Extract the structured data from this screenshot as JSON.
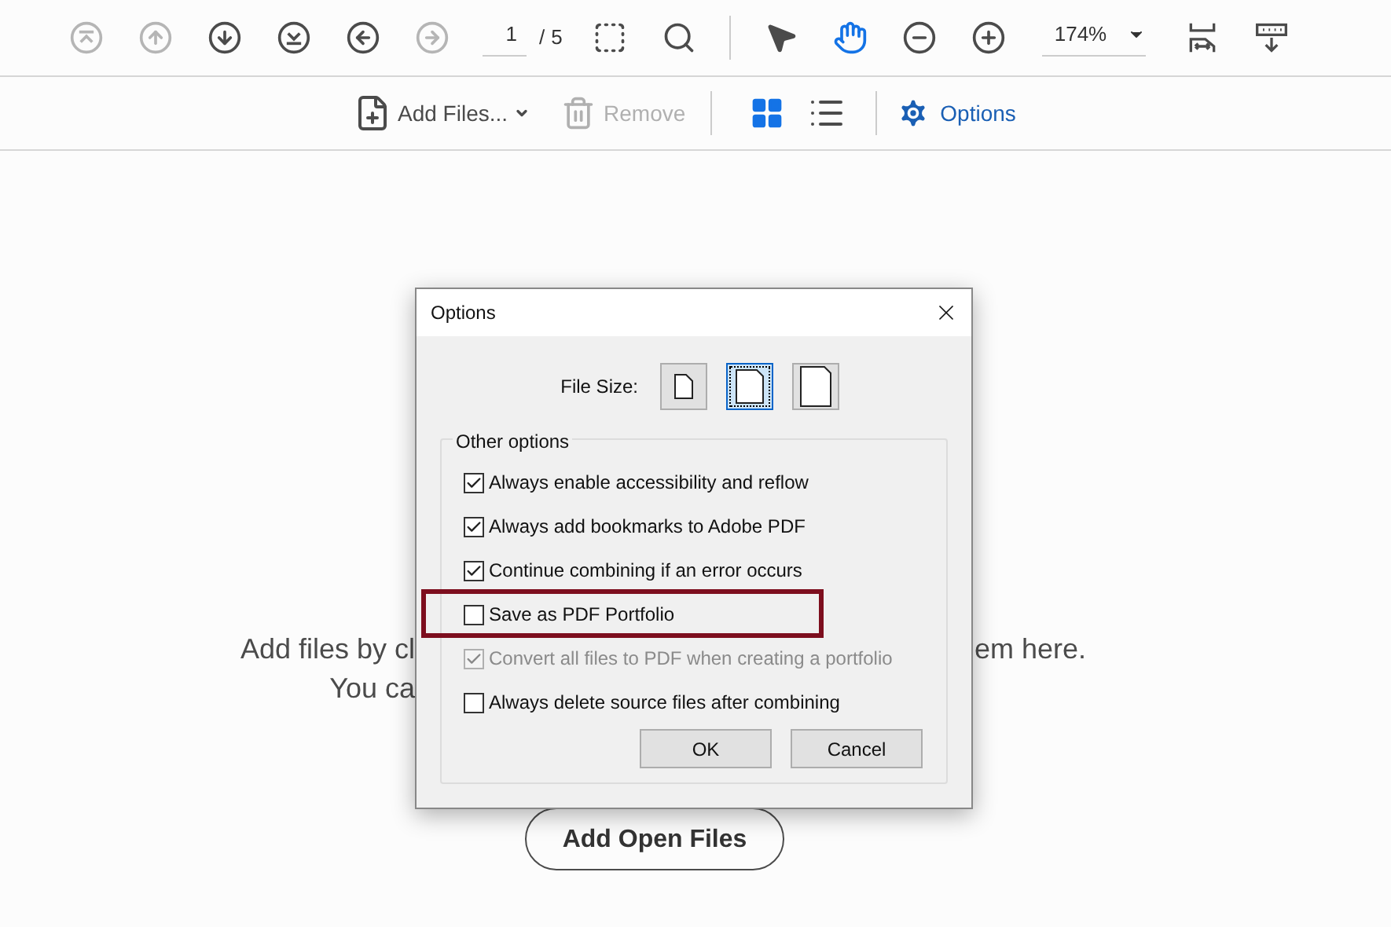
{
  "toolbar": {
    "tools": [
      {
        "kind": "first-page",
        "disabled": true
      },
      {
        "kind": "prev-page",
        "disabled": true
      },
      {
        "kind": "next-page",
        "disabled": false
      },
      {
        "kind": "last-page",
        "disabled": false
      },
      {
        "kind": "back",
        "disabled": false
      },
      {
        "kind": "forward",
        "disabled": true
      }
    ],
    "page": {
      "value": "1",
      "separator": "/",
      "total": "5"
    },
    "zoom_tools": [
      {
        "kind": "marquee-zoom"
      },
      {
        "kind": "loupe"
      }
    ],
    "mode_tools": [
      {
        "kind": "select",
        "selected": false
      },
      {
        "kind": "hand",
        "selected": true
      },
      {
        "kind": "zoom-out",
        "selected": false
      },
      {
        "kind": "zoom-in",
        "selected": false
      }
    ],
    "zoom": {
      "value": "174%"
    },
    "end_tools": [
      {
        "kind": "fit-page"
      },
      {
        "kind": "read-mode"
      }
    ]
  },
  "files_bar": {
    "add_files": {
      "label": "Add Files...",
      "disabled": false
    },
    "remove": {
      "label": "Remove",
      "disabled": true
    },
    "views": [
      {
        "kind": "grid",
        "selected": true
      },
      {
        "kind": "list",
        "selected": false
      }
    ],
    "options": {
      "label": "Options"
    }
  },
  "main": {
    "line_1": {
      "left": "Add files by cl",
      "right": "em here."
    },
    "line_2": {
      "left": "You ca"
    },
    "add_open_files": "Add Open Files"
  },
  "dialog": {
    "title": "Options",
    "file_size": {
      "label": "File Size:",
      "sizes": [
        {
          "kind": "small",
          "selected": false
        },
        {
          "kind": "medium",
          "selected": true
        },
        {
          "kind": "large",
          "selected": false
        }
      ]
    },
    "group_title": "Other options",
    "options": [
      {
        "label": "Always enable accessibility and reflow",
        "checked": true,
        "disabled": false,
        "highlighted": false
      },
      {
        "label": "Always add bookmarks to Adobe PDF",
        "checked": true,
        "disabled": false,
        "highlighted": false
      },
      {
        "label": "Continue combining if an error occurs",
        "checked": true,
        "disabled": false,
        "highlighted": false
      },
      {
        "label": "Save as PDF Portfolio",
        "checked": false,
        "disabled": false,
        "highlighted": true
      },
      {
        "label": "Convert all files to PDF when creating a portfolio",
        "checked": true,
        "disabled": true,
        "highlighted": false
      },
      {
        "label": "Always delete source files after combining",
        "checked": false,
        "disabled": false,
        "highlighted": false
      }
    ],
    "buttons": [
      "OK",
      "Cancel"
    ]
  }
}
